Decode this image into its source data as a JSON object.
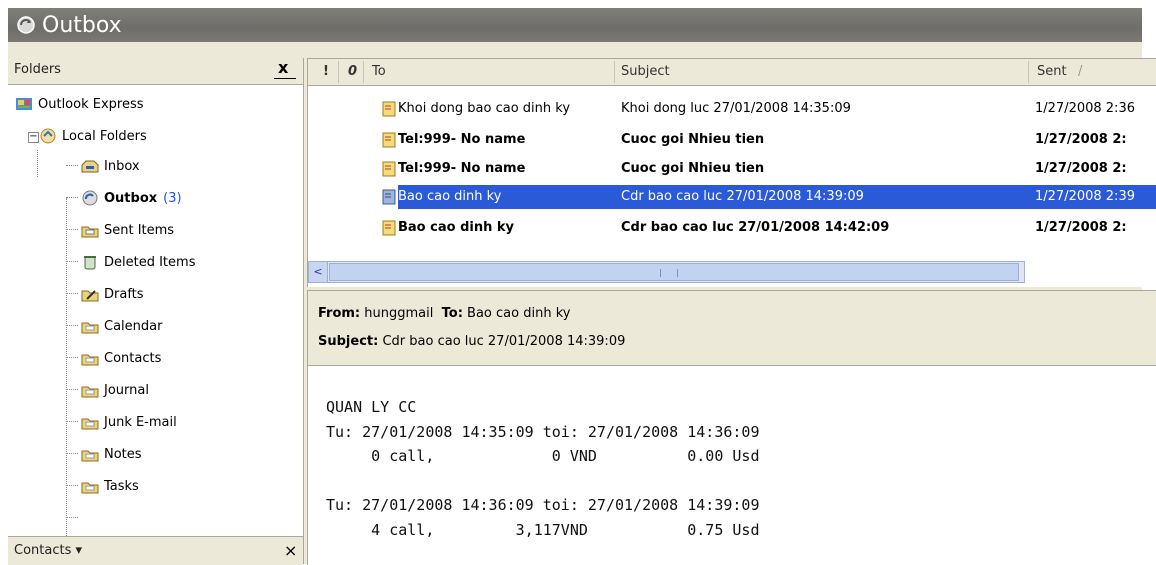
{
  "window": {
    "title": "Outbox"
  },
  "folders_pane": {
    "header": "Folders",
    "close": "x",
    "items": [
      {
        "label": "Outlook Express",
        "icon": "outlook-express-icon"
      },
      {
        "label": "Local Folders",
        "icon": "local-folders-icon"
      },
      {
        "label": "Inbox",
        "icon": "inbox-icon"
      },
      {
        "label": "Outbox",
        "count": "(3)",
        "icon": "outbox-icon"
      },
      {
        "label": "Sent Items",
        "icon": "sent-items-icon"
      },
      {
        "label": "Deleted Items",
        "icon": "deleted-items-icon"
      },
      {
        "label": "Drafts",
        "icon": "drafts-icon"
      },
      {
        "label": "Calendar",
        "icon": "folder-icon"
      },
      {
        "label": "Contacts",
        "icon": "folder-icon"
      },
      {
        "label": "Journal",
        "icon": "folder-icon"
      },
      {
        "label": "Junk E-mail",
        "icon": "folder-icon"
      },
      {
        "label": "Notes",
        "icon": "folder-icon"
      },
      {
        "label": "Tasks",
        "icon": "folder-icon"
      }
    ]
  },
  "contacts_pane": {
    "label": "Contacts ▾",
    "close": "×"
  },
  "message_list": {
    "columns": {
      "priority": "!",
      "attach": "0",
      "to": "To",
      "subject": "Subject",
      "sent": "Sent",
      "sent_sort": "/"
    },
    "rows": [
      {
        "to": "Khoi dong bao cao dinh ky",
        "subject": "Khoi dong luc 27/01/2008 14:35:09",
        "sent": "1/27/2008 2:36",
        "bold": false,
        "selected": false
      },
      {
        "to": "Tel:999- No name",
        "subject": "Cuoc goi Nhieu tien",
        "sent": "1/27/2008 2:",
        "bold": true,
        "selected": false
      },
      {
        "to": "Tel:999- No name",
        "subject": "Cuoc goi Nhieu tien",
        "sent": "1/27/2008 2:",
        "bold": true,
        "selected": false
      },
      {
        "to": "Bao cao dinh ky",
        "subject": "Cdr bao cao luc 27/01/2008 14:39:09",
        "sent": "1/27/2008 2:39",
        "bold": false,
        "selected": true
      },
      {
        "to": "Bao cao dinh ky",
        "subject": "Cdr bao cao luc 27/01/2008 14:42:09",
        "sent": "1/27/2008 2:",
        "bold": true,
        "selected": false
      }
    ],
    "scroll_left": "<"
  },
  "preview": {
    "from_label": "From:",
    "from": "hunggmail",
    "to_label": "To:",
    "to": "Bao cao dinh ky",
    "subject_label": "Subject:",
    "subject": "Cdr bao cao luc 27/01/2008 14:39:09",
    "body": "QUAN LY CC\nTu: 27/01/2008 14:35:09 toi: 27/01/2008 14:36:09\n     0 call,             0 VND          0.00 Usd\n\nTu: 27/01/2008 14:36:09 toi: 27/01/2008 14:39:09\n     4 call,         3,117VND           0.75 Usd"
  },
  "colors": {
    "selection": "#2a5ad7",
    "count": "#1f4fff",
    "chrome": "#ece9d8",
    "title_bar": "#75746f"
  }
}
